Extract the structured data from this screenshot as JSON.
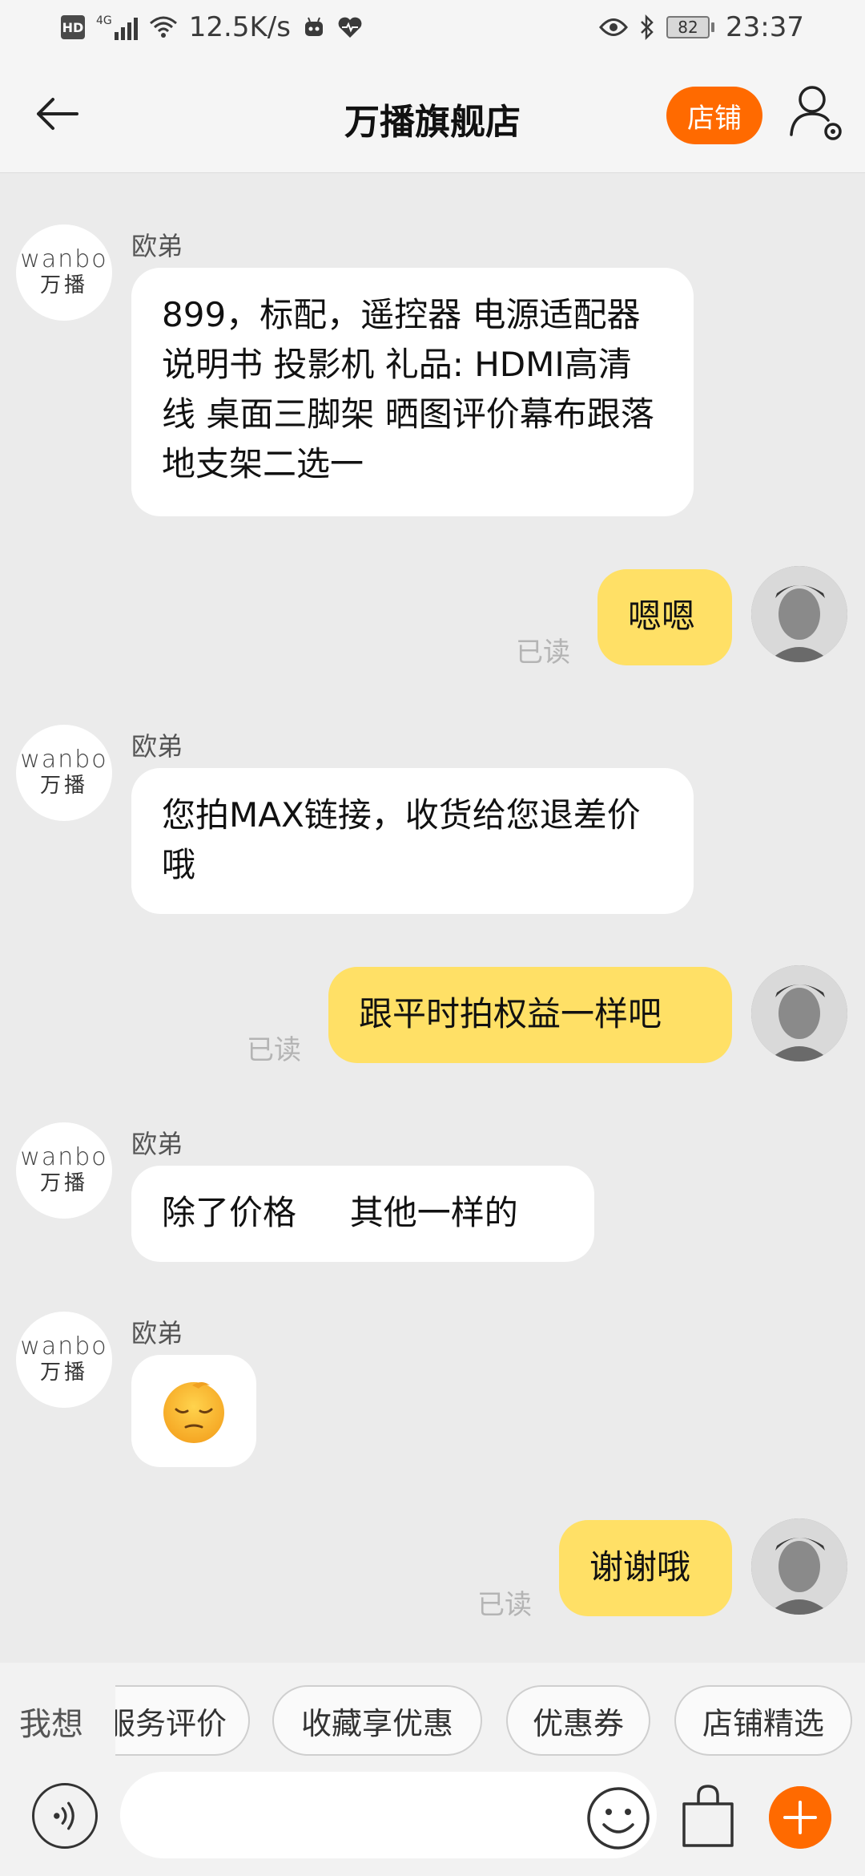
{
  "status_bar": {
    "net_speed": "12.5K/s",
    "network_type": "4G",
    "battery": "82",
    "time": "23:37"
  },
  "header": {
    "title": "万播旗舰店",
    "shop_label": "店铺"
  },
  "brand": {
    "logo_en": "wanbo",
    "logo_cn": "万播"
  },
  "messages": [
    {
      "side": "in",
      "sender": "欧弟",
      "text": "899，标配，遥控器 电源适配器 说明书 投影机 礼品: HDMI高清线  桌面三脚架  晒图评价幕布跟落地支架二选一"
    },
    {
      "side": "out",
      "text": "嗯嗯",
      "status": "已读"
    },
    {
      "side": "in",
      "sender": "欧弟",
      "text": "您拍MAX链接，收货给您退差价哦"
    },
    {
      "side": "out",
      "text": "跟平时拍权益一样吧",
      "status": "已读"
    },
    {
      "side": "in",
      "sender": "欧弟",
      "text": "除了价格     其他一样的"
    },
    {
      "side": "in",
      "sender": "欧弟",
      "emoji": "😔"
    },
    {
      "side": "out",
      "text": "谢谢哦",
      "status": "已读"
    }
  ],
  "quick_bar": {
    "label": "我想",
    "chips": [
      "服务评价",
      "收藏享优惠",
      "优惠券",
      "店铺精选"
    ]
  },
  "input": {
    "placeholder": ""
  },
  "colors": {
    "accent": "#ff6a00",
    "outgoing_bubble": "#ffe066",
    "incoming_bubble": "#ffffff",
    "background": "#ebebeb"
  }
}
